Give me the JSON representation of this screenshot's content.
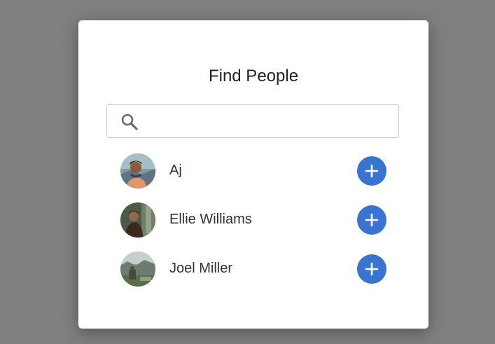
{
  "dialog": {
    "title": "Find People",
    "search": {
      "placeholder": "",
      "value": "",
      "icon": "search-icon"
    },
    "people": [
      {
        "name": "Aj",
        "action_icon": "plus-icon"
      },
      {
        "name": "Ellie Williams",
        "action_icon": "plus-icon"
      },
      {
        "name": "Joel Miller",
        "action_icon": "plus-icon"
      }
    ]
  },
  "colors": {
    "backdrop": "#808080",
    "dialog_background": "#ffffff",
    "accent": "#3a74d1",
    "text": "#333333"
  }
}
